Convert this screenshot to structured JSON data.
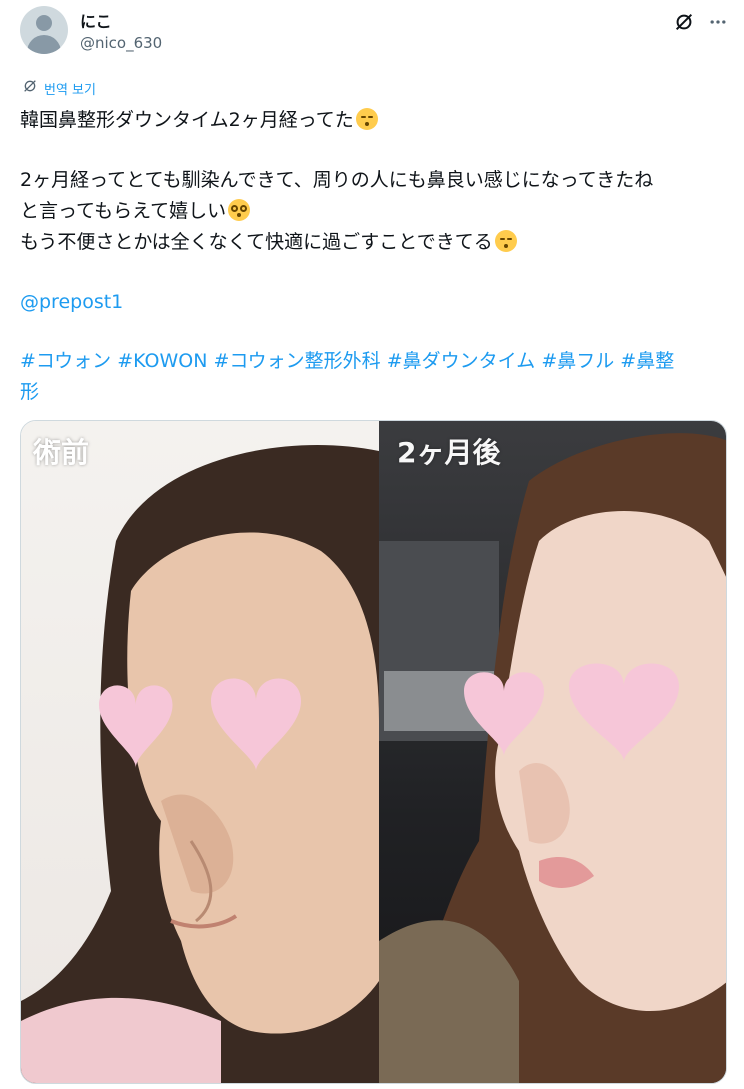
{
  "user": {
    "name": "にこ",
    "handle": "@nico_630"
  },
  "translate_label": "번역 보기",
  "tweet": {
    "line1": "韓国鼻整形ダウンタイム2ヶ月経ってた",
    "line2": "2ヶ月経ってとても馴染んできて、周りの人にも鼻良い感じになってきたね",
    "line3": "と言ってもらえて嬉しい",
    "line4": "もう不便さとかは全くなくて快適に過ごすことできてる",
    "mention": "@prepost1",
    "hashtags": [
      "#コウォン",
      "#KOWON",
      "#コウォン整形外科",
      "#鼻ダウンタイム",
      "#鼻フル",
      "#鼻整",
      "形"
    ]
  },
  "media": {
    "before_label": "術前",
    "after_label": "2ヶ月後"
  },
  "icons": [
    "grok-icon",
    "more-icon",
    "translate-icon",
    "kissing-face-icon",
    "pleading-face-icon"
  ]
}
